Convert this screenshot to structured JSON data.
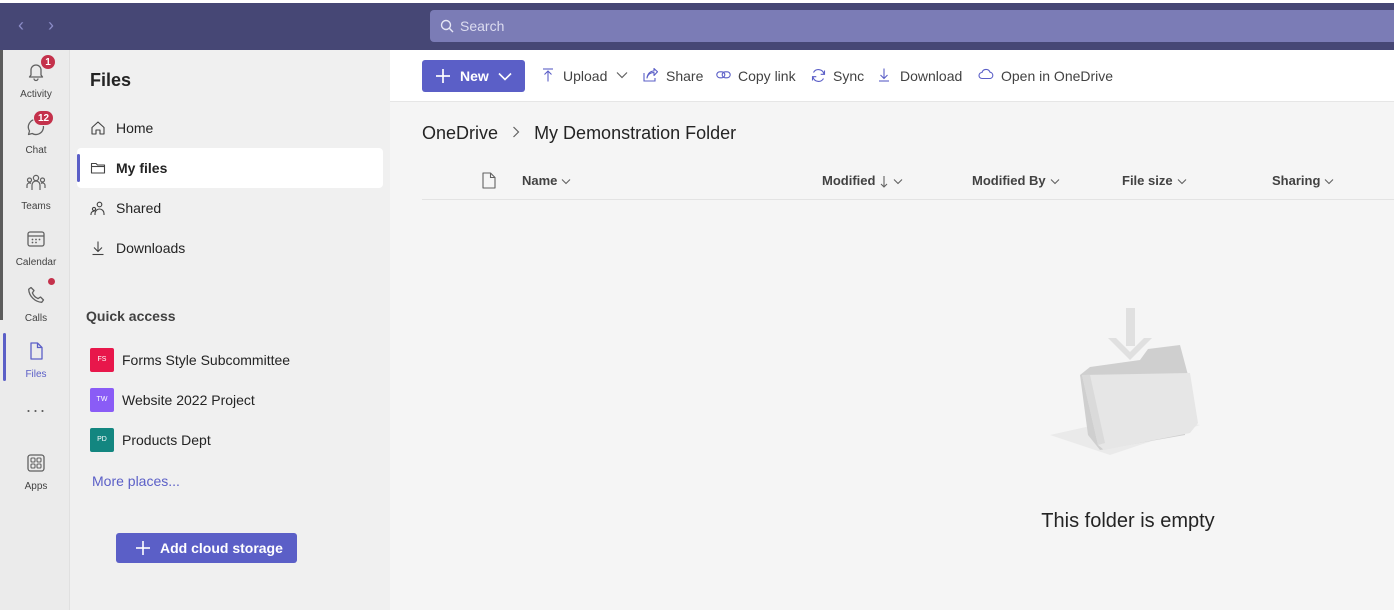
{
  "search": {
    "placeholder": "Search"
  },
  "rail": {
    "items": [
      {
        "label": "Activity",
        "badge": "1"
      },
      {
        "label": "Chat",
        "badge": "12"
      },
      {
        "label": "Teams"
      },
      {
        "label": "Calendar"
      },
      {
        "label": "Calls"
      },
      {
        "label": "Files"
      },
      {
        "label": "Apps"
      }
    ],
    "more": "···"
  },
  "leftpane": {
    "title": "Files",
    "nav": [
      {
        "label": "Home"
      },
      {
        "label": "My files"
      },
      {
        "label": "Shared"
      },
      {
        "label": "Downloads"
      }
    ],
    "quick_access_label": "Quick access",
    "quick_access": [
      {
        "initials": "FS",
        "label": "Forms Style Subcommittee",
        "color": "#e8174b"
      },
      {
        "initials": "TW",
        "label": "Website 2022 Project",
        "color": "#8a5cf6"
      },
      {
        "initials": "PD",
        "label": "Products Dept",
        "color": "#138680"
      }
    ],
    "more_places": "More places...",
    "add_cloud_storage": "Add cloud storage"
  },
  "toolbar": {
    "new_label": "New",
    "upload": "Upload",
    "share": "Share",
    "copy_link": "Copy link",
    "sync": "Sync",
    "download": "Download",
    "open_onedrive": "Open in OneDrive"
  },
  "breadcrumb": {
    "root": "OneDrive",
    "current": "My Demonstration Folder"
  },
  "columns": {
    "name": "Name",
    "modified": "Modified",
    "modified_by": "Modified By",
    "file_size": "File size",
    "sharing": "Sharing"
  },
  "empty": {
    "message": "This folder is empty"
  },
  "colors": {
    "accent": "#5b5fc7",
    "titlebar": "#464775",
    "badge": "#c4314b"
  }
}
